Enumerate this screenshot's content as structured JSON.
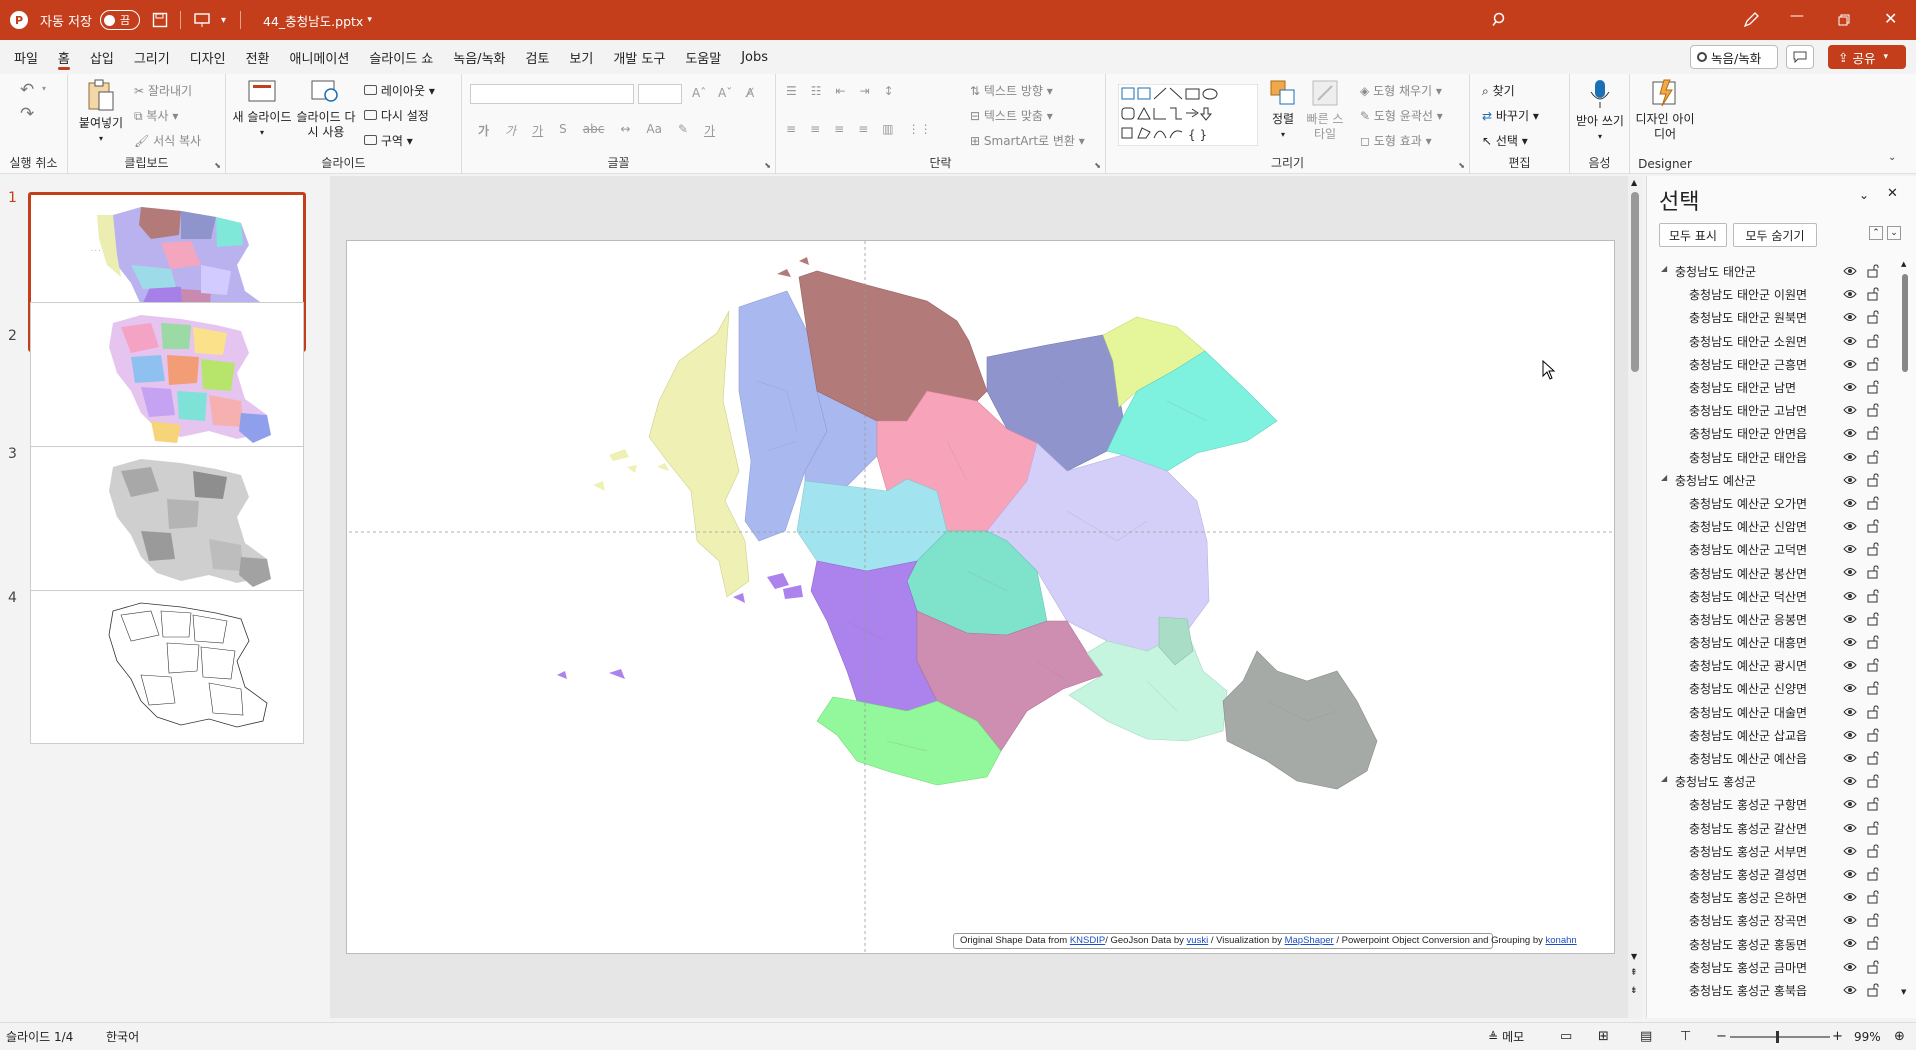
{
  "titlebar": {
    "autosave_label": "자동 저장",
    "autosave_state": "끔",
    "filename": "44_충청남도.pptx"
  },
  "menu": [
    "파일",
    "홈",
    "삽입",
    "그리기",
    "디자인",
    "전환",
    "애니메이션",
    "슬라이드 쇼",
    "녹음/녹화",
    "검토",
    "보기",
    "개발 도구",
    "도움말",
    "Jobs"
  ],
  "menu_right": {
    "record": "녹음/녹화",
    "share": "공유"
  },
  "ribbon": {
    "undo_group": "실행 취소",
    "clipboard": {
      "label": "클립보드",
      "paste": "붙여넣기",
      "cut": "잘라내기",
      "copy": "복사",
      "format_painter": "서식 복사"
    },
    "slides": {
      "label": "슬라이드",
      "new_slide": "새 슬라이드",
      "reuse": "슬라이드 다시 사용",
      "layout": "레이아웃",
      "reset": "다시 설정",
      "section": "구역"
    },
    "font": {
      "label": "글꼴"
    },
    "paragraph": {
      "label": "단락",
      "text_direction": "텍스트 방향",
      "align_text": "텍스트 맞춤",
      "smartart": "SmartArt로 변환"
    },
    "drawing": {
      "label": "그리기",
      "arrange": "정렬",
      "quick_styles": "빠른 스타일",
      "fill": "도형 채우기",
      "outline": "도형 윤곽선",
      "effects": "도형 효과"
    },
    "editing": {
      "label": "편집",
      "find": "찾기",
      "replace": "바꾸기",
      "select": "선택"
    },
    "voice": {
      "label": "음성",
      "dictate": "받아 쓰기"
    },
    "designer": {
      "label": "Designer",
      "ideas": "디자인 아이디어"
    }
  },
  "thumbnails": [
    "1",
    "2",
    "3",
    "4"
  ],
  "slide": {
    "credit_prefix": "Original Shape Data from",
    "credit_knsdip": "KNSDIP",
    "credit_mid1": "/ GeoJson Data by",
    "credit_vuski": "vuski",
    "credit_mid2": " / Visualization  by",
    "credit_mapshaper": "MapShaper",
    "credit_mid3": " / Powerpoint Object Conversion and Grouping  by",
    "credit_konahn": "konahn"
  },
  "selection_pane": {
    "title": "선택",
    "show_all": "모두 표시",
    "hide_all": "모두 숨기기",
    "items": [
      {
        "level": 0,
        "label": "충청남도 태안군"
      },
      {
        "level": 1,
        "label": "충청남도 태안군 이원면"
      },
      {
        "level": 1,
        "label": "충청남도 태안군 원북면"
      },
      {
        "level": 1,
        "label": "충청남도 태안군 소원면"
      },
      {
        "level": 1,
        "label": "충청남도 태안군 근흥면"
      },
      {
        "level": 1,
        "label": "충청남도 태안군 남면"
      },
      {
        "level": 1,
        "label": "충청남도 태안군 고남면"
      },
      {
        "level": 1,
        "label": "충청남도 태안군 안면읍"
      },
      {
        "level": 1,
        "label": "충청남도 태안군 태안읍"
      },
      {
        "level": 0,
        "label": "충청남도 예산군"
      },
      {
        "level": 1,
        "label": "충청남도 예산군 오가면"
      },
      {
        "level": 1,
        "label": "충청남도 예산군 신암면"
      },
      {
        "level": 1,
        "label": "충청남도 예산군 고덕면"
      },
      {
        "level": 1,
        "label": "충청남도 예산군 봉산면"
      },
      {
        "level": 1,
        "label": "충청남도 예산군 덕산면"
      },
      {
        "level": 1,
        "label": "충청남도 예산군 응봉면"
      },
      {
        "level": 1,
        "label": "충청남도 예산군 대흥면"
      },
      {
        "level": 1,
        "label": "충청남도 예산군 광시면"
      },
      {
        "level": 1,
        "label": "충청남도 예산군 신양면"
      },
      {
        "level": 1,
        "label": "충청남도 예산군 대술면"
      },
      {
        "level": 1,
        "label": "충청남도 예산군 삽교읍"
      },
      {
        "level": 1,
        "label": "충청남도 예산군 예산읍"
      },
      {
        "level": 0,
        "label": "충청남도 홍성군"
      },
      {
        "level": 1,
        "label": "충청남도 홍성군 구항면"
      },
      {
        "level": 1,
        "label": "충청남도 홍성군 갈산면"
      },
      {
        "level": 1,
        "label": "충청남도 홍성군 서부면"
      },
      {
        "level": 1,
        "label": "충청남도 홍성군 결성면"
      },
      {
        "level": 1,
        "label": "충청남도 홍성군 은하면"
      },
      {
        "level": 1,
        "label": "충청남도 홍성군 장곡면"
      },
      {
        "level": 1,
        "label": "충청남도 홍성군 홍동면"
      },
      {
        "level": 1,
        "label": "충청남도 홍성군 금마면"
      },
      {
        "level": 1,
        "label": "충청남도 홍성군 홍북읍"
      }
    ]
  },
  "status": {
    "slide_info": "슬라이드 1/4",
    "language": "한국어",
    "notes": "메모",
    "zoom": "99%"
  },
  "colors": {
    "accent": "#c43e1c"
  }
}
